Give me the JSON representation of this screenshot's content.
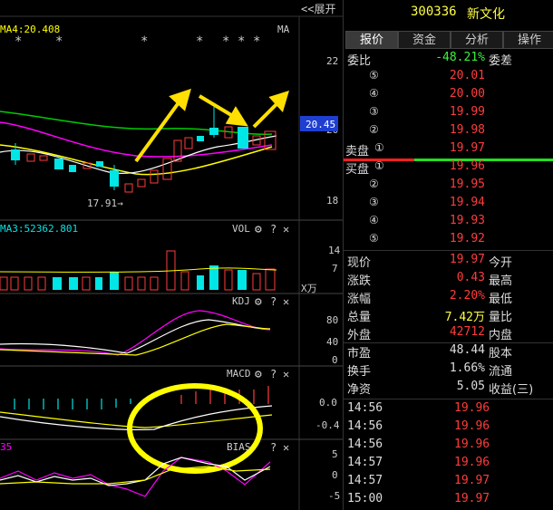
{
  "chart": {
    "ma_label": "MA4:20.408",
    "expand_label": "<<展开",
    "ma_tag": "MA",
    "price_axis": [
      "22",
      "20",
      "18"
    ],
    "current_price_tag": "20.45",
    "low_annotation": "17.91→",
    "vol_label": "VOL",
    "ma3_label": "MA3:52362.801",
    "vol_axis": [
      "14",
      "7",
      "X万"
    ],
    "kdj_label": "KDJ",
    "kdj_axis": [
      "80",
      "40",
      "0"
    ],
    "macd_label": "MACD",
    "macd_axis": [
      "0.0",
      "-0.4"
    ],
    "bias_label": "BIAS",
    "bias_value": "35",
    "bias_axis": [
      "5",
      "0",
      "-5"
    ],
    "icons": {
      "gear": "gear-icon",
      "help": "help-icon",
      "close": "close-icon"
    },
    "colors": {
      "up": "#ff3c3c",
      "down": "#00e5e5",
      "ma_white": "#ffffff",
      "ma_yellow": "#ffff00",
      "ma_magenta": "#ff00ff",
      "ma_green": "#00cc00",
      "annotation": "#ffe000"
    }
  },
  "quote": {
    "code": "300336",
    "name": "新文化",
    "tabs": [
      "报价",
      "资金",
      "分析",
      "操作"
    ],
    "weibi_label": "委比",
    "weibi_value": "-48.21%",
    "weicha_label": "委差",
    "sell_label": "卖盘",
    "buy_label": "买盘",
    "sell_levels": [
      {
        "n": "⑤",
        "price": "20.01"
      },
      {
        "n": "④",
        "price": "20.00"
      },
      {
        "n": "③",
        "price": "19.99"
      },
      {
        "n": "②",
        "price": "19.98"
      },
      {
        "n": "①",
        "price": "19.97"
      }
    ],
    "buy_levels": [
      {
        "n": "①",
        "price": "19.96"
      },
      {
        "n": "②",
        "price": "19.95"
      },
      {
        "n": "③",
        "price": "19.94"
      },
      {
        "n": "④",
        "price": "19.93"
      },
      {
        "n": "⑤",
        "price": "19.92"
      }
    ],
    "stats": [
      {
        "l1": "现价",
        "v": "19.97",
        "vc": "red",
        "l2": "今开"
      },
      {
        "l1": "涨跌",
        "v": "0.43",
        "vc": "red",
        "l2": "最高"
      },
      {
        "l1": "涨幅",
        "v": "2.20%",
        "vc": "red",
        "l2": "最低"
      },
      {
        "l1": "总量",
        "v": "7.42万",
        "vc": "yellow",
        "l2": "量比"
      },
      {
        "l1": "外盘",
        "v": "42712",
        "vc": "red",
        "l2": "内盘"
      }
    ],
    "fundamentals": [
      {
        "l1": "市盈",
        "v": "48.44",
        "l2": "股本"
      },
      {
        "l1": "换手",
        "v": "1.66%",
        "l2": "流通"
      },
      {
        "l1": "净资",
        "v": "5.05",
        "l2": "收益(三)"
      }
    ],
    "ticks": [
      {
        "time": "14:56",
        "price": "19.96"
      },
      {
        "time": "14:56",
        "price": "19.96"
      },
      {
        "time": "14:56",
        "price": "19.96"
      },
      {
        "time": "14:57",
        "price": "19.96"
      },
      {
        "time": "14:57",
        "price": "19.97"
      },
      {
        "time": "15:00",
        "price": "19.97"
      }
    ]
  }
}
